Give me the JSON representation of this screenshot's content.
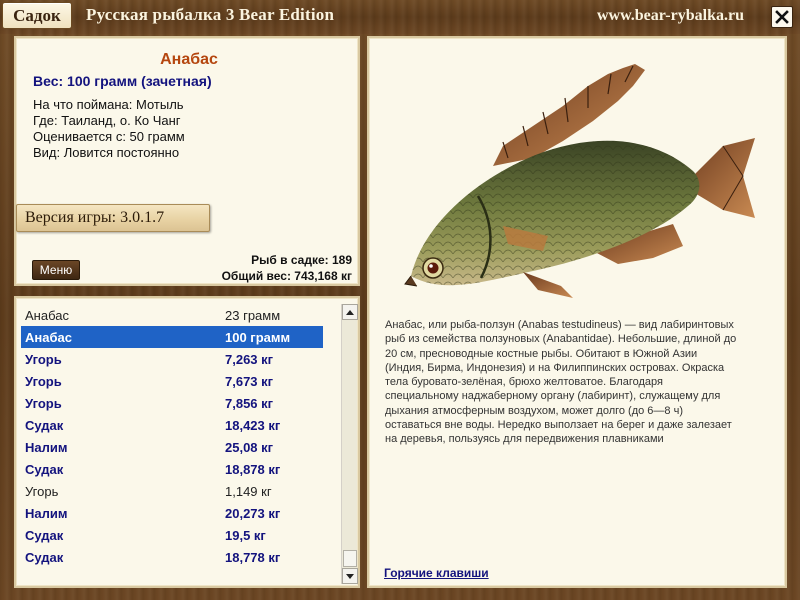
{
  "titlebar": {
    "sadok_label": "Садок",
    "game_title": "Русская рыбалка 3 Bear Edition",
    "site_url": "www.bear-rybalka.ru",
    "close_icon": "close-icon"
  },
  "fish_info": {
    "name": "Анабас",
    "weight": "Вес: 100 грамм (зачетная)",
    "caught_on": "На что поймана: Мотыль",
    "location": "Где: Таиланд, о. Ко Чанг",
    "valued_from": "Оценивается с: 50 грамм",
    "type": "Вид: Ловится постоянно"
  },
  "version": "Версия игры: 3.0.1.7",
  "menu_label": "Меню",
  "stats": {
    "fish_count": "Рыб в садке: 189",
    "total_weight": "Общий вес: 743,168 кг"
  },
  "catch_list": [
    {
      "name": "Анабас",
      "weight": "23 грамм",
      "style": "normal"
    },
    {
      "name": "Анабас",
      "weight": "100 грамм",
      "style": "selected"
    },
    {
      "name": "Угорь",
      "weight": "7,263 кг",
      "style": "bold"
    },
    {
      "name": "Угорь",
      "weight": "7,673 кг",
      "style": "bold"
    },
    {
      "name": "Угорь",
      "weight": "7,856 кг",
      "style": "bold"
    },
    {
      "name": "Судак",
      "weight": "18,423 кг",
      "style": "bold"
    },
    {
      "name": "Налим",
      "weight": "25,08 кг",
      "style": "bold"
    },
    {
      "name": "Судак",
      "weight": "18,878 кг",
      "style": "bold"
    },
    {
      "name": "Угорь",
      "weight": "1,149 кг",
      "style": "normal"
    },
    {
      "name": "Налим",
      "weight": "20,273 кг",
      "style": "bold"
    },
    {
      "name": "Судак",
      "weight": "19,5 кг",
      "style": "bold"
    },
    {
      "name": "Судак",
      "weight": "18,778 кг",
      "style": "bold"
    }
  ],
  "description": "Анабас, или рыба-ползун (Anabas testudineus) — вид лабиринтовых рыб из семейства ползуновых (Anabantidae). Небольшие, длиной до 20 см, пресноводные костные рыбы. Обитают в Южной Азии (Индия, Бирма, Индонезия) и на Филиппинских островах. Окраска тела буровато-зелёная, брюхо желтоватое. Благодаря специальному наджаберному органу (лабиринт), служащему для дыхания атмосферным воздухом, может долго (до 6—8 ч) оставаться вне воды. Нередко выползает на берег и даже залезает на деревья, пользуясь для передвижения плавниками",
  "hotkeys_label": "Горячие клавиши",
  "colors": {
    "wood": "#5c3b1b",
    "panel": "#fbf8ea",
    "fish_name": "#b5460f",
    "link_blue": "#13137e",
    "selection": "#1f63c6"
  }
}
